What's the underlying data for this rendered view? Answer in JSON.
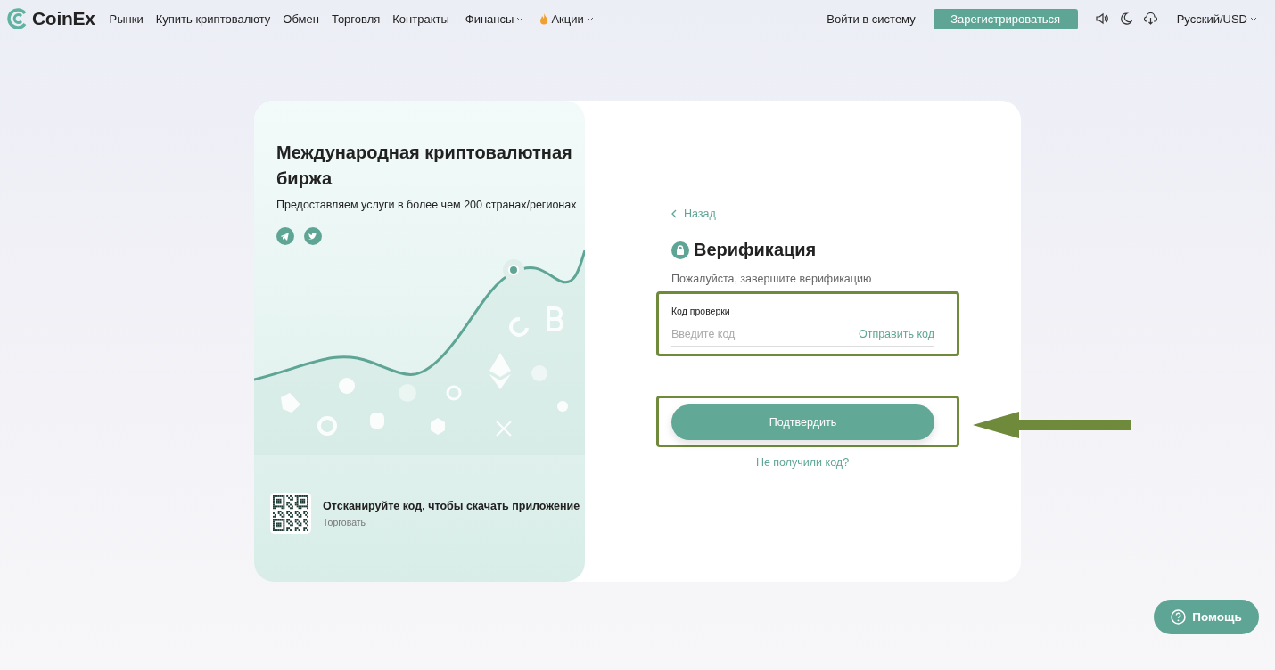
{
  "header": {
    "logo": "CoinEx",
    "nav": [
      {
        "label": "Рынки",
        "kind": "link"
      },
      {
        "label": "Купить криптовалюту",
        "kind": "link"
      },
      {
        "label": "Обмен",
        "kind": "link"
      },
      {
        "label": "Торговля",
        "kind": "link"
      },
      {
        "label": "Контракты",
        "kind": "link"
      },
      {
        "label": "Финансы",
        "kind": "menu"
      },
      {
        "label": "Акции",
        "kind": "promo"
      }
    ],
    "login": "Войти в систему",
    "register": "Зарегистрироваться",
    "language": "Русский/USD"
  },
  "promo": {
    "title": "Международная криптовалютная биржа",
    "subtitle": "Предоставляем услуги в более чем 200 странах/регионах",
    "qr_title": "Отсканируйте код, чтобы скачать приложение",
    "qr_subtitle": "Торговать"
  },
  "form": {
    "back": "Назад",
    "title": "Верификация",
    "subtitle": "Пожалуйста, завершите верификацию",
    "field_label": "Код проверки",
    "placeholder": "Введите код",
    "send_code": "Отправить код",
    "submit": "Подтвердить",
    "no_code": "Не получили код?"
  },
  "help": "Помощь"
}
